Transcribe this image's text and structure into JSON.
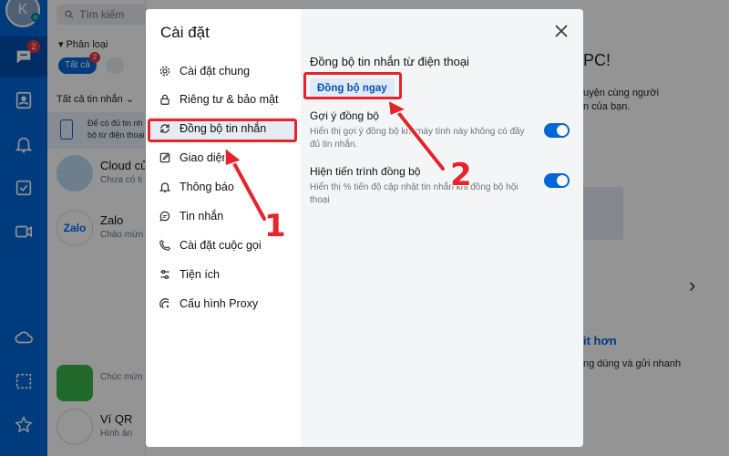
{
  "rail": {
    "avatar_initial": "K",
    "chat_badge": "2"
  },
  "list": {
    "search_placeholder": "Tìm kiếm",
    "filter_label": "Phân loại",
    "chip_all": "Tất cả",
    "chip_badge": "2",
    "all_messages": "Tất cả tin nhắn",
    "sync_note_line1": "Để có đủ tin nh",
    "sync_note_line2": "bộ từ điện thoại",
    "conversations": [
      {
        "name": "Cloud củ",
        "preview": "Chưa có ti"
      },
      {
        "name": "Zalo",
        "preview": "Chào mừn"
      },
      {
        "name": "",
        "preview": "Chúc mừn"
      },
      {
        "name": "Ví QR",
        "preview": "Hình ản"
      }
    ]
  },
  "bg_right": {
    "pc": "PC!",
    "line1": "uyện cùng người",
    "line2": "n của bạn.",
    "heading": "it hơn",
    "line3": "ng dùng và gửi nhanh"
  },
  "dialog": {
    "title": "Cài đặt",
    "menu": [
      {
        "label": "Cài đặt chung",
        "icon": "gear-icon"
      },
      {
        "label": "Riêng tư & bảo mật",
        "icon": "lock-icon"
      },
      {
        "label": "Đồng bộ tin nhắn",
        "icon": "sync-icon"
      },
      {
        "label": "Giao diện",
        "icon": "edit-icon"
      },
      {
        "label": "Thông báo",
        "icon": "bell-icon"
      },
      {
        "label": "Tin nhắn",
        "icon": "message-icon"
      },
      {
        "label": "Cài đặt cuộc gọi",
        "icon": "phone-icon"
      },
      {
        "label": "Tiện ích",
        "icon": "sliders-icon"
      },
      {
        "label": "Cấu hình Proxy",
        "icon": "proxy-icon"
      }
    ],
    "section_title": "Đồng bộ tin nhắn từ điện thoại",
    "sync_now": "Đồng bộ ngay",
    "options": [
      {
        "title": "Gợi ý đồng bộ",
        "desc": "Hiển thị gợi ý đồng bộ khi máy tính này không có đầy đủ tin nhắn.",
        "enabled": true
      },
      {
        "title": "Hiện tiến trình đồng bộ",
        "desc": "Hiển thị % tiến độ cập nhật tin nhắn khi đồng bộ hội thoại",
        "enabled": true
      }
    ]
  },
  "annotations": {
    "step1": "1",
    "step2": "2",
    "color": "#e5242b"
  }
}
